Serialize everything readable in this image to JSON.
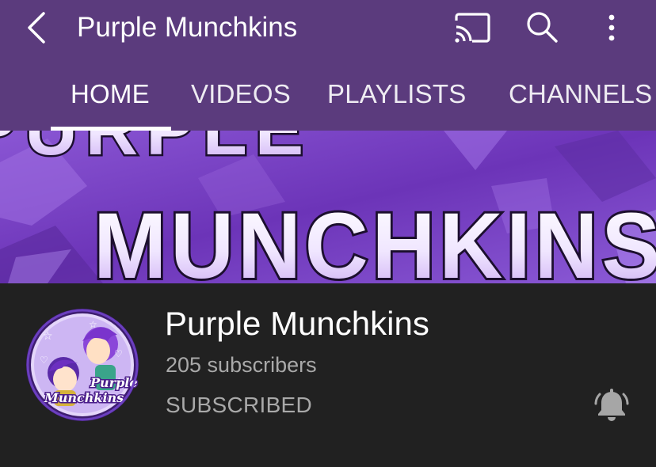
{
  "appbar": {
    "title": "Purple Munchkins",
    "back_icon": "back-arrow-icon",
    "cast_icon": "cast-icon",
    "search_icon": "search-icon",
    "more_icon": "more-vert-icon"
  },
  "tabs": [
    {
      "label": "HOME",
      "active": true
    },
    {
      "label": "VIDEOS",
      "active": false
    },
    {
      "label": "PLAYLISTS",
      "active": false
    },
    {
      "label": "CHANNELS",
      "active": false
    }
  ],
  "banner": {
    "line1": "PURPLE",
    "line2": "MUNCHKINS"
  },
  "channel": {
    "name": "Purple Munchkins",
    "subscribers": "205 subscribers",
    "subscribe_state": "SUBSCRIBED",
    "avatar_text_line1": "Purple",
    "avatar_text_line2": "Munchkins",
    "bell_icon": "notification-bell-icon"
  },
  "colors": {
    "header_bg": "#5b3b7d",
    "page_bg": "#212121",
    "primary_text": "#ffffff",
    "secondary_text": "#a9a9a9"
  }
}
